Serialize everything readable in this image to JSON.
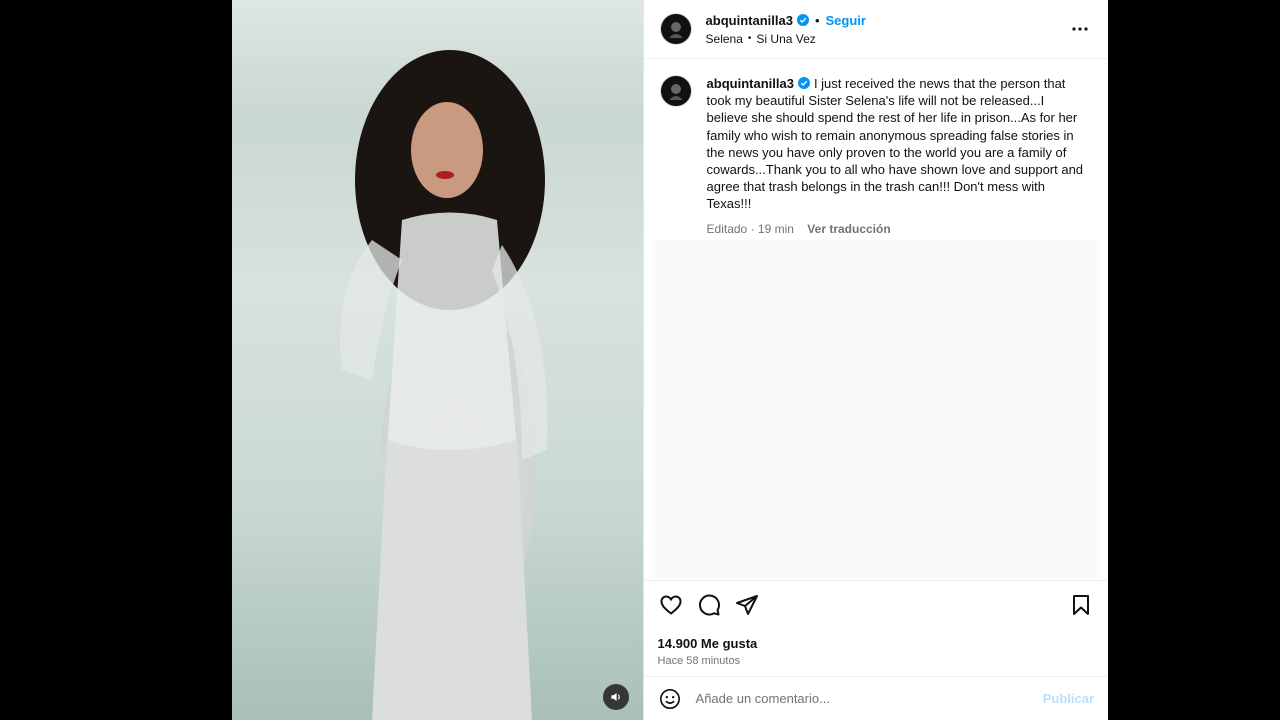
{
  "post": {
    "username": "abquintanilla3",
    "follow_label": "Seguir",
    "separator": "•",
    "audio_artist": "Selena",
    "audio_track": "Si Una Vez",
    "more_icon": "more-horizontal-icon"
  },
  "caption": {
    "username": "abquintanilla3",
    "text": "I just received the news that the person that took my beautiful Sister Selena's life will not be released...I believe she should spend the rest of her life in prison...As for her family who wish to remain anonymous spreading false stories in the news you have only proven to the world you are a family of cowards...Thank you to all who have shown love and support and agree that trash belongs in the trash can!!! Don't mess with Texas!!!",
    "edited_label": "Editado",
    "separator": "·",
    "age": "19 min",
    "translate_label": "Ver traducción"
  },
  "stats": {
    "likes": "14.900 Me gusta",
    "posted": "Hace 58 minutos"
  },
  "comment": {
    "placeholder": "Añade un comentario...",
    "post_label": "Publicar"
  },
  "colors": {
    "accent": "#0095f6",
    "verified": "#0095f6",
    "muted": "#737373",
    "post_disabled": "#b9dffc"
  },
  "icons": [
    "heart-icon",
    "comment-icon",
    "share-icon",
    "bookmark-icon",
    "emoji-icon",
    "volume-icon",
    "verified-badge-icon"
  ]
}
